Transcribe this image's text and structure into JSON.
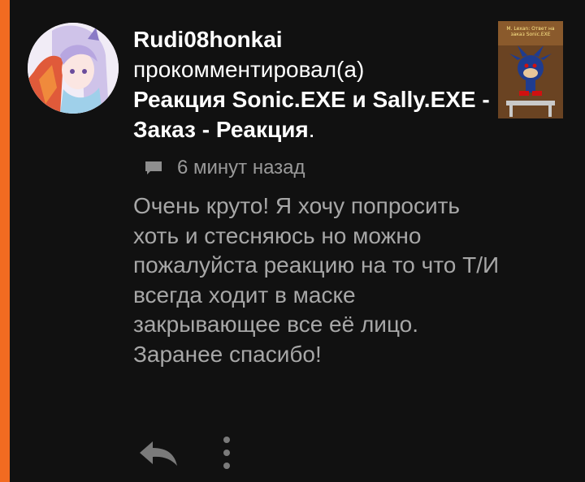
{
  "colors": {
    "accent": "#f26b21",
    "background": "#111111",
    "text_primary": "#ffffff",
    "text_secondary": "#a7a7a7",
    "meta": "#9a9a9a"
  },
  "notification": {
    "username": "Rudi08honkai",
    "action": "прокомментировал(а)",
    "post_title": "Реакция Sonic.EXE и Sally.EXE - Заказ - Реакция",
    "post_title_end": ".",
    "timestamp": "6 минут назад",
    "comment": "Очень круто! Я хочу попросить хоть и стесняюсь но можно пожалуйста реакцию на то что Т/И всегда ходит в маске закрывающее все её лицо. Заранее спасибо!",
    "thumbnail_caption": "М. Lexan: Ответ на заказ Sonic.EXE"
  },
  "icons": {
    "avatar": "user-avatar",
    "thumbnail": "post-thumbnail",
    "comment": "comment-icon",
    "reply": "reply-icon",
    "more": "more-vertical-icon"
  }
}
